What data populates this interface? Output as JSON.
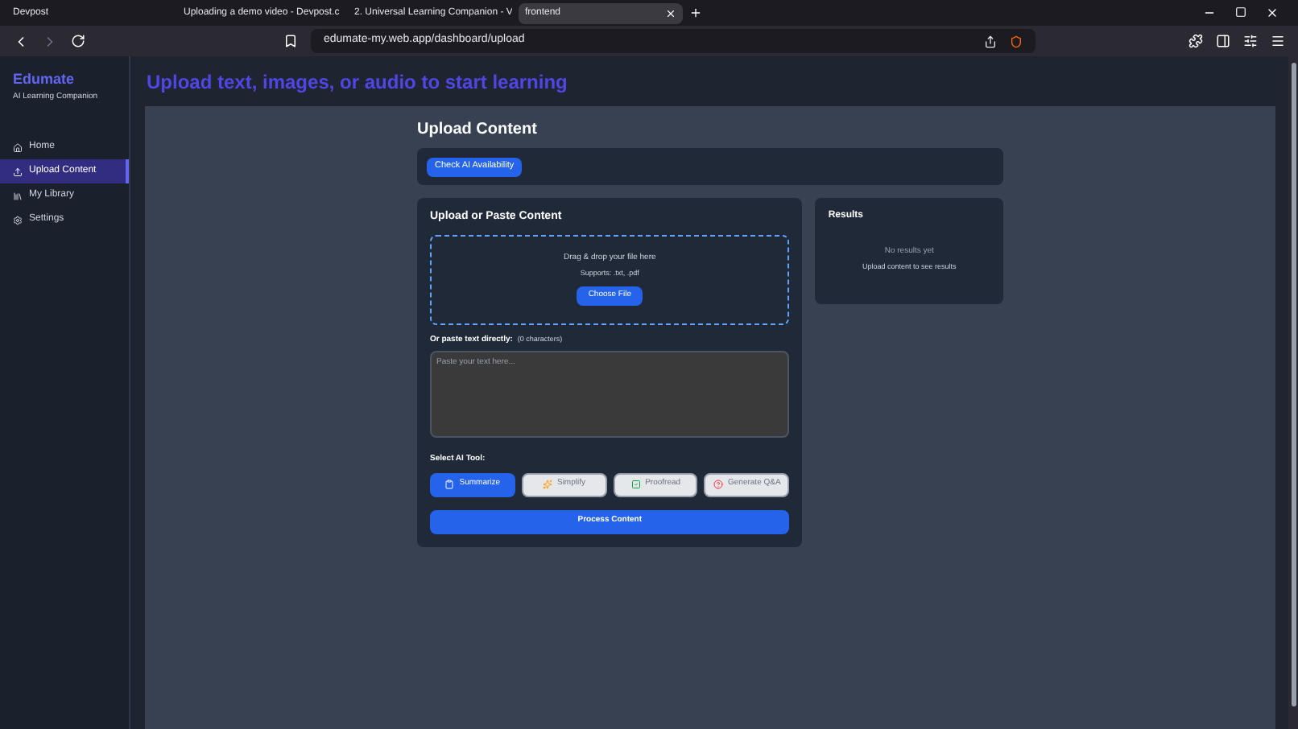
{
  "browser": {
    "tabs": [
      {
        "label": "Devpost",
        "selected": false
      },
      {
        "label": "Uploading a demo video - Devpost.c",
        "selected": false
      },
      {
        "label": "2. Universal Learning Companion - V",
        "selected": false
      },
      {
        "label": "frontend",
        "selected": true
      }
    ],
    "url": "edumate-my.web.app/dashboard/upload"
  },
  "sidebar": {
    "brand": "Edumate",
    "tagline": "AI Learning Companion",
    "items": [
      {
        "label": "Home",
        "selected": false
      },
      {
        "label": "Upload Content",
        "selected": true
      },
      {
        "label": "My Library",
        "selected": false
      },
      {
        "label": "Settings",
        "selected": false
      }
    ]
  },
  "header": {
    "title": "Upload text, images, or audio to start learning"
  },
  "page": {
    "title": "Upload Content",
    "check_button": "Check AI Availability"
  },
  "upload": {
    "title": "Upload or Paste Content",
    "drop_text": "Drag & drop your file here",
    "supports": "Supports: .txt, .pdf",
    "choose_button": "Choose File",
    "paste_label": "Or paste text directly:",
    "char_count": "(0 characters)",
    "placeholder": "Paste your text here...",
    "tools_label": "Select AI Tool:",
    "tools": [
      {
        "label": "Summarize",
        "selected": true
      },
      {
        "label": "Simplify",
        "selected": false
      },
      {
        "label": "Proofread",
        "selected": false
      },
      {
        "label": "Generate Q&A",
        "selected": false
      }
    ],
    "process_button": "Process Content"
  },
  "results": {
    "title": "Results",
    "empty": "No results yet",
    "hint": "Upload content to see results"
  }
}
